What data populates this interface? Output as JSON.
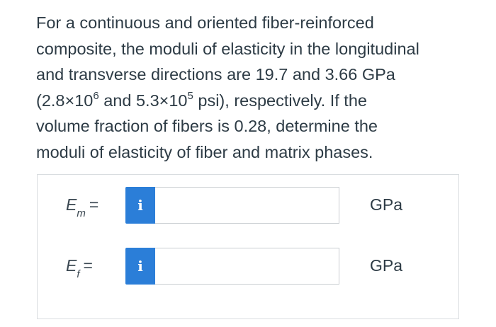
{
  "problem": {
    "line1": "For a continuous and oriented fiber-reinforced",
    "line2": "composite, the moduli of elasticity in the longitudinal",
    "line3": "and transverse directions are 19.7 and 3.66 GPa",
    "line4_a": "(2.8×10",
    "line4_exp1": "6",
    "line4_b": " and 5.3×10",
    "line4_exp2": "5",
    "line4_c": " psi), respectively. If the",
    "line5": "volume fraction of fibers is 0.28, determine the",
    "line6": "moduli of elasticity of fiber and matrix phases."
  },
  "answers": {
    "em": {
      "symbol": "E",
      "subscript": "m",
      "equals": "=",
      "info": "i",
      "value": "",
      "unit": "GPa"
    },
    "ef": {
      "symbol": "E",
      "subscript": "f",
      "equals": "=",
      "info": "i",
      "value": "",
      "unit": "GPa"
    }
  }
}
